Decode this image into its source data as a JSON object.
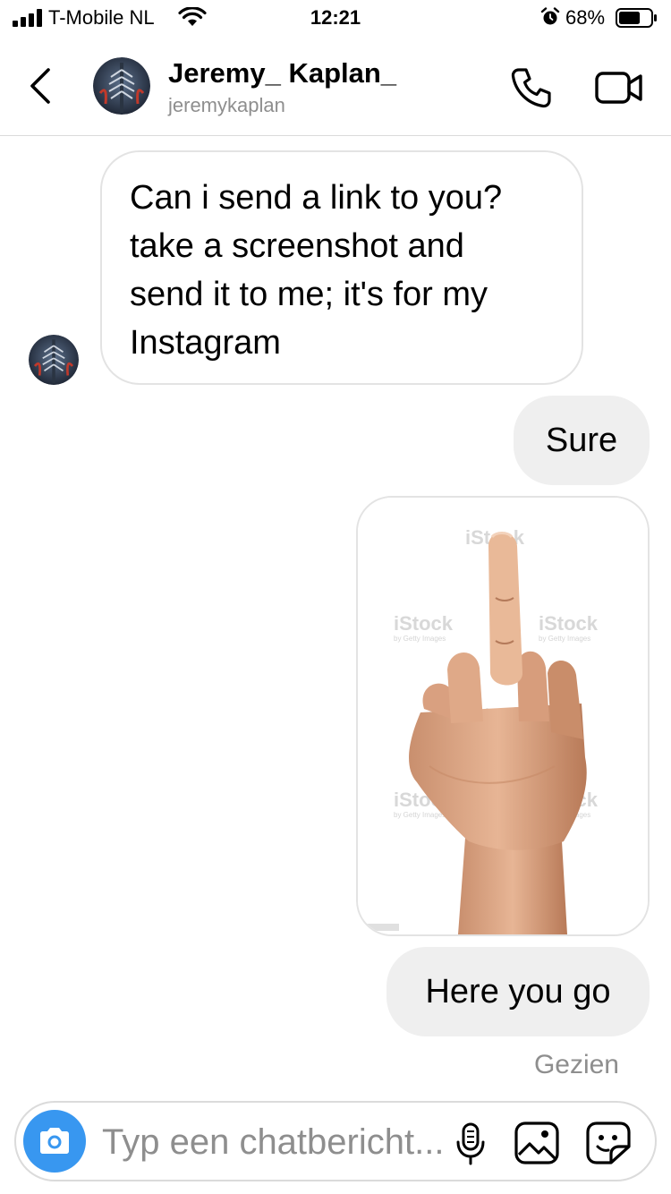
{
  "status_bar": {
    "carrier": "T-Mobile NL",
    "time": "12:21",
    "battery": "68%",
    "battery_level": 0.68,
    "signal_bars": 4
  },
  "header": {
    "name": "Jeremy_ Kaplan_",
    "username": "jeremykaplan"
  },
  "messages": [
    {
      "from": "contact",
      "type": "text",
      "text": "Can i send a link to you?\ntake a screenshot and\nsend it to me; it's for my\nInstagram"
    },
    {
      "from": "me",
      "type": "text",
      "text": "Sure"
    },
    {
      "from": "me",
      "type": "image",
      "subject": "hand-middle-finger",
      "watermark": "iStock",
      "watermark_sub": "by Getty Images"
    },
    {
      "from": "me",
      "type": "text",
      "text": "Here you go"
    }
  ],
  "seen_label": "Gezien",
  "composer": {
    "placeholder": "Typ een chatbericht..."
  },
  "icons": {
    "back": "chevron-left-icon",
    "call": "phone-icon",
    "video": "video-camera-icon",
    "camera": "camera-icon",
    "mic": "microphone-icon",
    "gallery": "image-gallery-icon",
    "sticker": "sticker-icon"
  },
  "colors": {
    "accent": "#3897f0",
    "bubble_out": "#efefef",
    "bubble_in_border": "#e3e3e3",
    "secondary_text": "#8e8e8e"
  }
}
